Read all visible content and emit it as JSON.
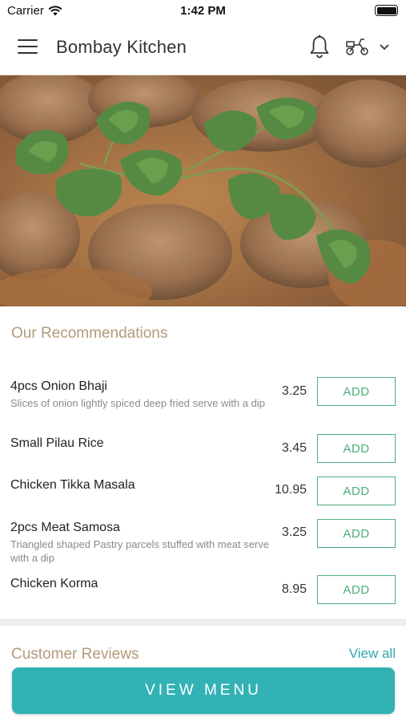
{
  "status_bar": {
    "carrier": "Carrier",
    "time": "1:42 PM"
  },
  "header": {
    "title": "Bombay Kitchen",
    "icons": [
      "menu-icon",
      "bell-icon",
      "scooter-icon",
      "chevron-down-icon"
    ]
  },
  "recommendations": {
    "title": "Our Recommendations",
    "add_label": "ADD",
    "items": [
      {
        "name": "4pcs Onion Bhaji",
        "description": "Slices of onion lightly spiced deep fried serve with a dip",
        "price": "3.25"
      },
      {
        "name": "Small Pilau Rice",
        "description": "",
        "price": "3.45"
      },
      {
        "name": "Chicken Tikka Masala",
        "description": "",
        "price": "10.95"
      },
      {
        "name": "2pcs Meat Samosa",
        "description": "Triangled shaped Pastry parcels stuffed with meat serve with a dip",
        "price": "3.25"
      },
      {
        "name": "Chicken Korma",
        "description": "",
        "price": "8.95"
      }
    ]
  },
  "reviews": {
    "title": "Customer Reviews",
    "view_all": "View all"
  },
  "view_menu_label": "VIEW MENU",
  "colors": {
    "accent": "#33b2b6",
    "add_green": "#4caf7a",
    "section_title": "#b19b7a",
    "link": "#2fa7b0"
  }
}
